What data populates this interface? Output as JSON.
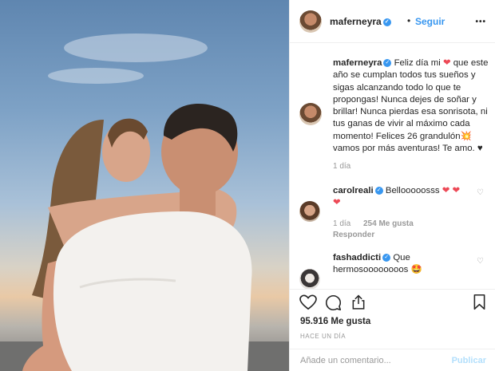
{
  "header": {
    "username": "maferneyra",
    "separator": "•",
    "follow_label": "Seguir",
    "more_label": "•••"
  },
  "caption": {
    "username": "maferneyra",
    "text_before_heart": "Feliz día mi",
    "text_after_heart": "que este año se cumplan todos tus sueños y sigas alcanzando todo lo que te propongas! Nunca dejes de soñar y brillar! Nunca pierdas esa sonrisota, ni tus ganas de vivir al máximo cada momento! Felices 26 grandulón",
    "text_end": "vamos por más aventuras! Te amo.",
    "heart": "❤",
    "burst": "💥",
    "black_heart": "♥",
    "time": "1 día"
  },
  "comments": [
    {
      "username": "carolreali",
      "text": "Bellooooosss",
      "hearts": "❤ ❤",
      "hearts2": "❤",
      "time": "1 día",
      "likes": "254 Me gusta",
      "reply": "Responder"
    },
    {
      "username": "fashaddicti",
      "text": "Que hermosoooooooos",
      "emoji": "🤩"
    }
  ],
  "actions": {
    "likes": "95.916 Me gusta",
    "ago": "HACE UN DÍA",
    "comment_placeholder": "Añade un comentario...",
    "publish_label": "Publicar"
  },
  "icons": {
    "like": "heart-outline-icon",
    "comment": "comment-icon",
    "share": "share-icon",
    "save": "bookmark-icon",
    "verified": "verified-badge-icon"
  },
  "colors": {
    "link_blue": "#3897f0",
    "heart_red": "#ed4956",
    "muted": "#999999",
    "publish_disabled": "#b2dffc"
  }
}
